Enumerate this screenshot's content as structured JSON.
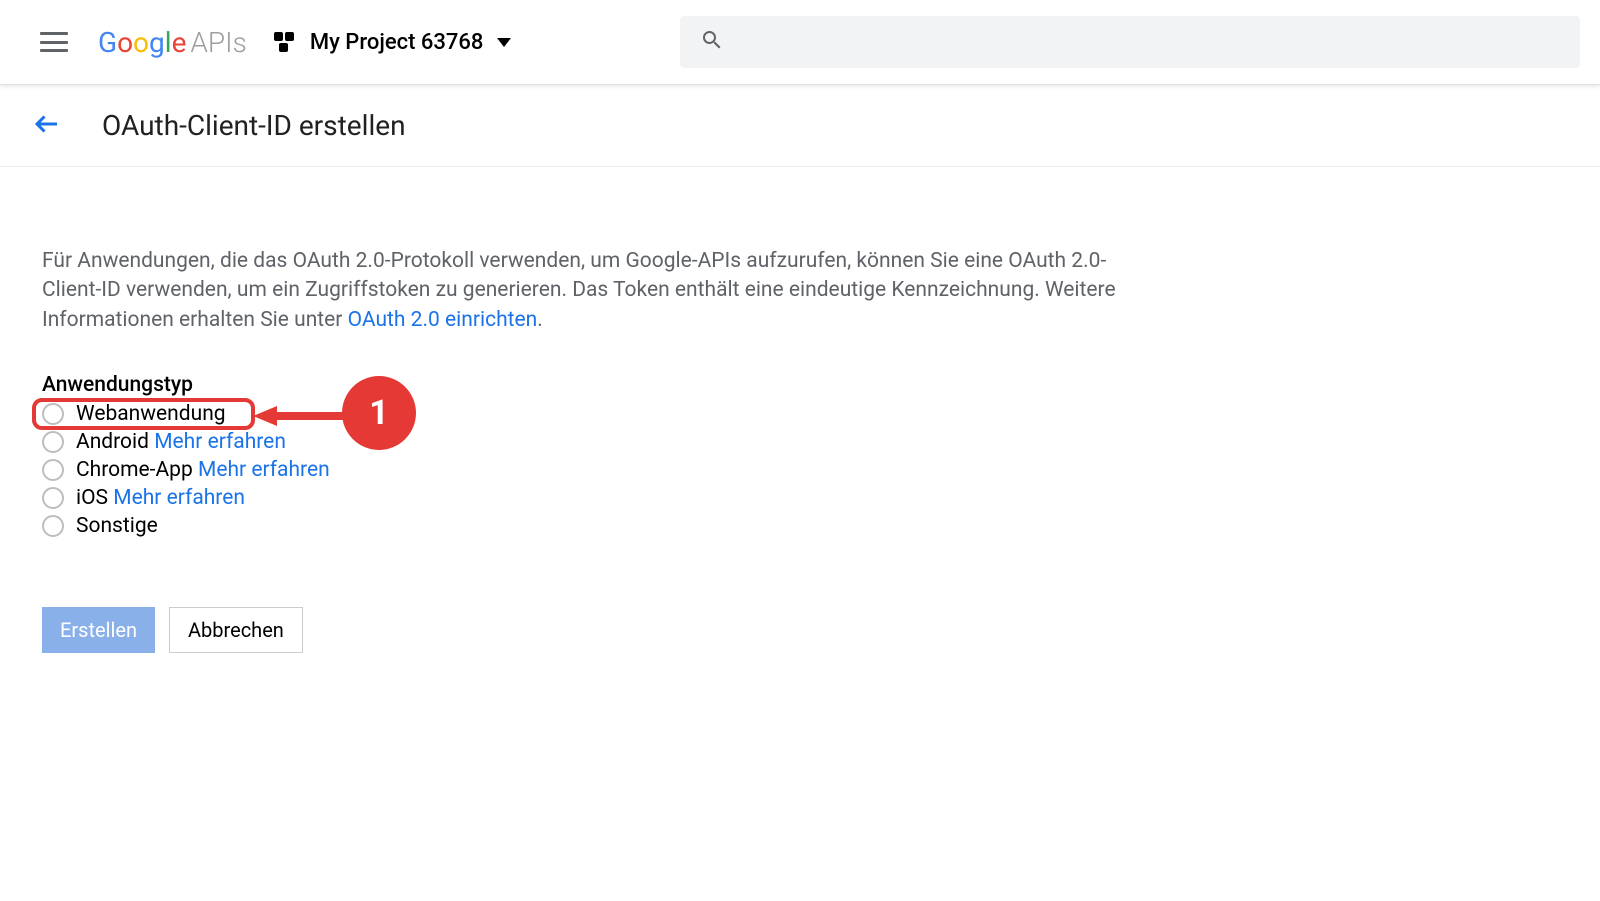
{
  "header": {
    "logo_google": "Google",
    "logo_apis": "APIs",
    "project_name": "My Project 63768"
  },
  "subheader": {
    "page_title": "OAuth-Client-ID erstellen"
  },
  "content": {
    "description_part1": "Für Anwendungen, die das OAuth 2.0-Protokoll verwenden, um Google-APIs aufzurufen, können Sie eine OAuth 2.0-Client-ID verwenden, um ein Zugriffstoken zu generieren. Das Token enthält eine eindeutige Kennzeichnung. Weitere Informationen erhalten Sie unter ",
    "description_link": "OAuth 2.0 einrichten",
    "description_part2": ".",
    "section_label": "Anwendungstyp",
    "options": [
      {
        "label": "Webanwendung",
        "more": ""
      },
      {
        "label": "Android",
        "more": "Mehr erfahren"
      },
      {
        "label": "Chrome-App",
        "more": "Mehr erfahren"
      },
      {
        "label": "iOS",
        "more": "Mehr erfahren"
      },
      {
        "label": "Sonstige",
        "more": ""
      }
    ],
    "callout_number": "1"
  },
  "buttons": {
    "create": "Erstellen",
    "cancel": "Abbrechen"
  }
}
